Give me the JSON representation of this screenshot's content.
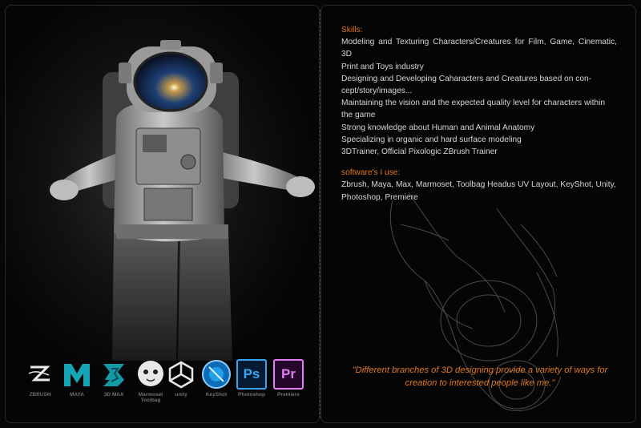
{
  "skills": {
    "title": "Skills:",
    "lines": [
      "Modeling and Texturing Characters/Creatures for Film, Game, Cinematic, 3D",
      "Print and Toys industry",
      "Designing and Developing Cahar­acters and Creatures based on con-",
      "cept/story/images...",
      "Maintaining the vision and the expected quality level for characters within",
      "the game",
      "Strong knowledge about Human and Animal Anatomy",
      "Specializing in organic and hard surface modeling",
      "3DTrainer, Official Pixologic ZBrush Trainer"
    ]
  },
  "software": {
    "title": "software's I use:",
    "lines": [
      "Zbrush, Maya, Max, Marmoset, Toolbag Headus UV Layout, KeyShot, Unity,",
      "Photoshop, Premiere"
    ]
  },
  "quote": {
    "line1": "\"Different branches of 3D designing provide a variety of ways for",
    "line2": "creation to interested people like me.\""
  },
  "logos": [
    {
      "name": "zbrush",
      "caption": "ZBRUSH",
      "icon": "zbrush-logo-icon"
    },
    {
      "name": "maya",
      "caption": "MAYA",
      "icon": "maya-logo-icon"
    },
    {
      "name": "3dmax",
      "caption": "3D MAX",
      "icon": "3dsmax-logo-icon"
    },
    {
      "name": "marmoset",
      "caption": "Marmoset Toolbag",
      "icon": "marmoset-logo-icon"
    },
    {
      "name": "unity",
      "caption": "unity",
      "icon": "unity-logo-icon"
    },
    {
      "name": "keyshot",
      "caption": "KeyShot",
      "icon": "keyshot-logo-icon"
    },
    {
      "name": "photoshop",
      "caption": "Photoshop",
      "label": "Ps",
      "icon": "photoshop-logo-icon"
    },
    {
      "name": "premiere",
      "caption": "Premiere",
      "label": "Pr",
      "icon": "premiere-logo-icon"
    }
  ],
  "colors": {
    "accent": "#e1781e",
    "body_text": "#d6d6d6",
    "photoshop": "#36a6f0",
    "premiere": "#e07df0"
  }
}
